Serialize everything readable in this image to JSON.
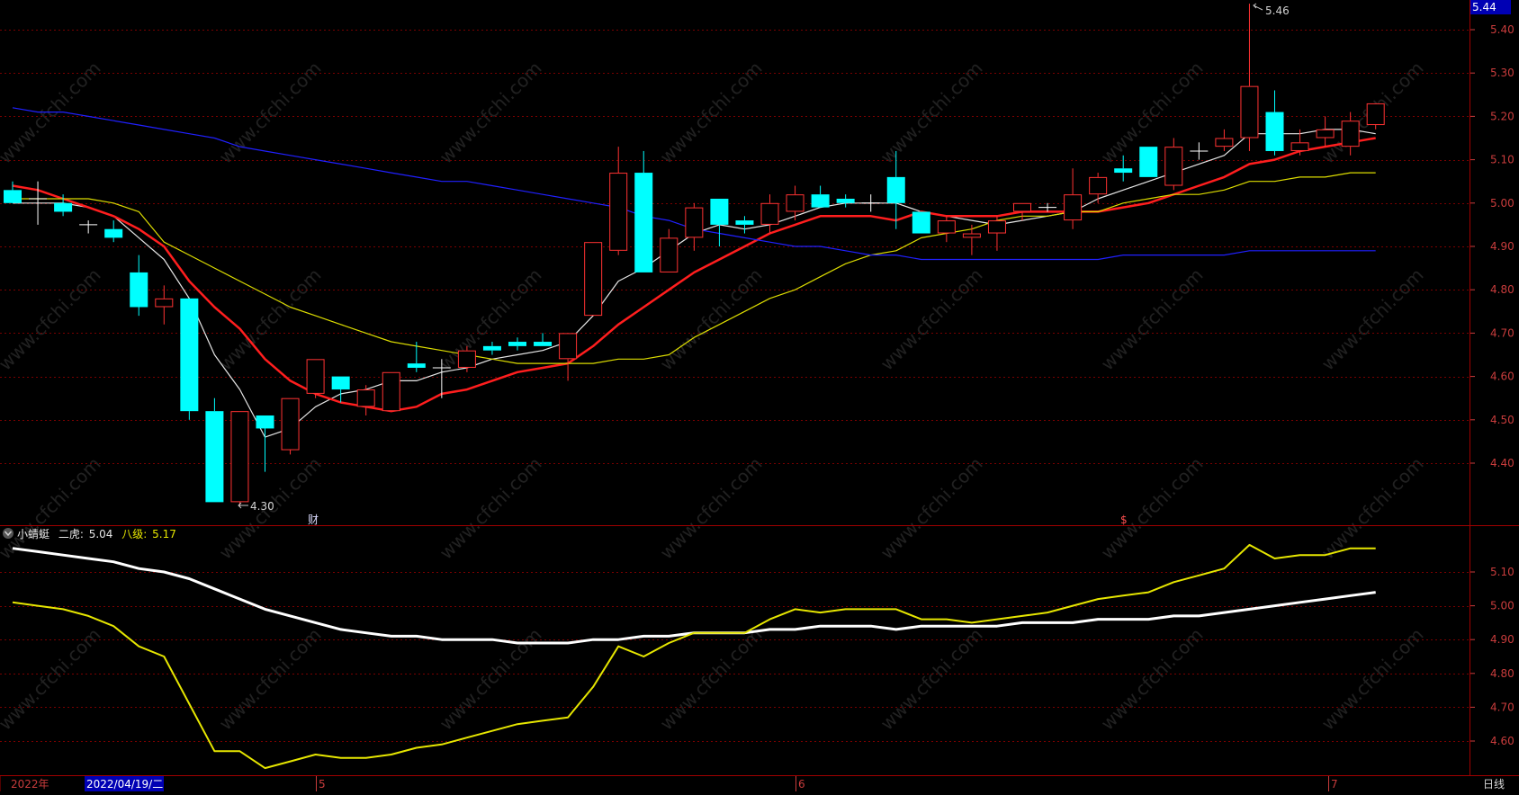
{
  "colors": {
    "background": "#000000",
    "up_candle": "#ff3232",
    "down_candle": "#00ffff",
    "grid": "#7a0000",
    "axis_text": "#c83c3c",
    "ma_white": "#e6e6e6",
    "ma_red": "#ff1e1e",
    "ma_yellow": "#dcdc00",
    "ma_blue": "#2020ff"
  },
  "price_axis": {
    "current_price": "5.44",
    "ticks": [
      "5.40",
      "5.30",
      "5.20",
      "5.10",
      "5.00",
      "4.90",
      "4.80",
      "4.70",
      "4.60",
      "4.50",
      "4.40"
    ]
  },
  "annotations": {
    "high": "5.46",
    "low": "4.30",
    "finance_marker": "财",
    "dollar_marker": "$"
  },
  "indicator": {
    "name": "小蜻蜓",
    "line1_label": "二虎:",
    "line1_value": "5.04",
    "line2_label": "八级:",
    "line2_value": "5.17",
    "ticks": [
      "5.10",
      "5.00",
      "4.90",
      "4.80",
      "4.70",
      "4.60"
    ]
  },
  "date_axis": {
    "year_label": "2022年",
    "selected_date": "2022/04/19/二",
    "month_labels": [
      "5",
      "6",
      "7"
    ],
    "period_label": "日线"
  },
  "watermark": "www.cfchi.com",
  "chart_data": [
    {
      "type": "candlestick",
      "title": "",
      "ylim": [
        4.25,
        5.47
      ],
      "grid": true,
      "candles": [
        {
          "o": 5.03,
          "h": 5.05,
          "l": 5.0,
          "c": 5.0
        },
        {
          "o": 5.01,
          "h": 5.05,
          "l": 4.95,
          "c": 5.01
        },
        {
          "o": 5.0,
          "h": 5.02,
          "l": 4.97,
          "c": 4.98
        },
        {
          "o": 4.95,
          "h": 4.96,
          "l": 4.93,
          "c": 4.95
        },
        {
          "o": 4.94,
          "h": 4.96,
          "l": 4.91,
          "c": 4.92
        },
        {
          "o": 4.84,
          "h": 4.88,
          "l": 4.74,
          "c": 4.76
        },
        {
          "o": 4.76,
          "h": 4.81,
          "l": 4.72,
          "c": 4.78
        },
        {
          "o": 4.78,
          "h": 4.78,
          "l": 4.5,
          "c": 4.52
        },
        {
          "o": 4.52,
          "h": 4.55,
          "l": 4.31,
          "c": 4.31
        },
        {
          "o": 4.31,
          "h": 4.52,
          "l": 4.3,
          "c": 4.52
        },
        {
          "o": 4.51,
          "h": 4.51,
          "l": 4.38,
          "c": 4.48
        },
        {
          "o": 4.43,
          "h": 4.55,
          "l": 4.42,
          "c": 4.55
        },
        {
          "o": 4.56,
          "h": 4.64,
          "l": 4.55,
          "c": 4.64
        },
        {
          "o": 4.6,
          "h": 4.6,
          "l": 4.54,
          "c": 4.57
        },
        {
          "o": 4.53,
          "h": 4.58,
          "l": 4.51,
          "c": 4.57
        },
        {
          "o": 4.52,
          "h": 4.61,
          "l": 4.52,
          "c": 4.61
        },
        {
          "o": 4.63,
          "h": 4.68,
          "l": 4.61,
          "c": 4.62
        },
        {
          "o": 4.62,
          "h": 4.64,
          "l": 4.55,
          "c": 4.62
        },
        {
          "o": 4.62,
          "h": 4.67,
          "l": 4.61,
          "c": 4.66
        },
        {
          "o": 4.67,
          "h": 4.68,
          "l": 4.65,
          "c": 4.66
        },
        {
          "o": 4.68,
          "h": 4.69,
          "l": 4.66,
          "c": 4.67
        },
        {
          "o": 4.68,
          "h": 4.7,
          "l": 4.67,
          "c": 4.67
        },
        {
          "o": 4.64,
          "h": 4.7,
          "l": 4.59,
          "c": 4.7
        },
        {
          "o": 4.74,
          "h": 4.91,
          "l": 4.74,
          "c": 4.91
        },
        {
          "o": 4.89,
          "h": 5.13,
          "l": 4.88,
          "c": 5.07
        },
        {
          "o": 5.07,
          "h": 5.12,
          "l": 4.84,
          "c": 4.84
        },
        {
          "o": 4.84,
          "h": 4.94,
          "l": 4.84,
          "c": 4.92
        },
        {
          "o": 4.92,
          "h": 5.0,
          "l": 4.89,
          "c": 4.99
        },
        {
          "o": 5.01,
          "h": 5.01,
          "l": 4.9,
          "c": 4.95
        },
        {
          "o": 4.96,
          "h": 4.97,
          "l": 4.93,
          "c": 4.95
        },
        {
          "o": 4.95,
          "h": 5.02,
          "l": 4.93,
          "c": 5.0
        },
        {
          "o": 4.98,
          "h": 5.04,
          "l": 4.96,
          "c": 5.02
        },
        {
          "o": 5.02,
          "h": 5.04,
          "l": 4.99,
          "c": 4.99
        },
        {
          "o": 5.01,
          "h": 5.02,
          "l": 4.99,
          "c": 5.0
        },
        {
          "o": 5.0,
          "h": 5.02,
          "l": 4.98,
          "c": 5.0
        },
        {
          "o": 5.06,
          "h": 5.12,
          "l": 4.94,
          "c": 5.0
        },
        {
          "o": 4.98,
          "h": 4.98,
          "l": 4.93,
          "c": 4.93
        },
        {
          "o": 4.93,
          "h": 4.97,
          "l": 4.91,
          "c": 4.96
        },
        {
          "o": 4.92,
          "h": 4.95,
          "l": 4.88,
          "c": 4.93
        },
        {
          "o": 4.93,
          "h": 4.97,
          "l": 4.89,
          "c": 4.96
        },
        {
          "o": 4.98,
          "h": 5.0,
          "l": 4.96,
          "c": 5.0
        },
        {
          "o": 4.99,
          "h": 5.0,
          "l": 4.98,
          "c": 4.99
        },
        {
          "o": 4.96,
          "h": 5.08,
          "l": 4.94,
          "c": 5.02
        },
        {
          "o": 5.02,
          "h": 5.07,
          "l": 5.0,
          "c": 5.06
        },
        {
          "o": 5.08,
          "h": 5.11,
          "l": 5.05,
          "c": 5.07
        },
        {
          "o": 5.13,
          "h": 5.13,
          "l": 5.06,
          "c": 5.06
        },
        {
          "o": 5.04,
          "h": 5.15,
          "l": 5.03,
          "c": 5.13
        },
        {
          "o": 5.12,
          "h": 5.14,
          "l": 5.1,
          "c": 5.12
        },
        {
          "o": 5.13,
          "h": 5.17,
          "l": 5.12,
          "c": 5.15
        },
        {
          "o": 5.15,
          "h": 5.46,
          "l": 5.12,
          "c": 5.27
        },
        {
          "o": 5.21,
          "h": 5.26,
          "l": 5.11,
          "c": 5.12
        },
        {
          "o": 5.12,
          "h": 5.17,
          "l": 5.11,
          "c": 5.14
        },
        {
          "o": 5.15,
          "h": 5.2,
          "l": 5.13,
          "c": 5.17
        },
        {
          "o": 5.13,
          "h": 5.21,
          "l": 5.11,
          "c": 5.19
        },
        {
          "o": 5.18,
          "h": 5.23,
          "l": 5.17,
          "c": 5.23
        }
      ],
      "series": [
        {
          "color": "#e6e6e6",
          "values": [
            5.0,
            5.0,
            5.0,
            4.99,
            4.97,
            4.92,
            4.87,
            4.78,
            4.65,
            4.57,
            4.46,
            4.48,
            4.53,
            4.56,
            4.57,
            4.59,
            4.59,
            4.61,
            4.62,
            4.64,
            4.65,
            4.66,
            4.68,
            4.74,
            4.82,
            4.85,
            4.89,
            4.93,
            4.95,
            4.94,
            4.95,
            4.97,
            4.99,
            5.0,
            5.0,
            5.0,
            4.98,
            4.97,
            4.96,
            4.95,
            4.96,
            4.97,
            4.98,
            5.01,
            5.03,
            5.05,
            5.07,
            5.09,
            5.11,
            5.16,
            5.16,
            5.16,
            5.17,
            5.17,
            5.16
          ]
        },
        {
          "color": "#ff1e1e",
          "values": [
            5.04,
            5.03,
            5.01,
            4.99,
            4.97,
            4.94,
            4.9,
            4.82,
            4.76,
            4.71,
            4.64,
            4.59,
            4.56,
            4.54,
            4.53,
            4.52,
            4.53,
            4.56,
            4.57,
            4.59,
            4.61,
            4.62,
            4.63,
            4.67,
            4.72,
            4.76,
            4.8,
            4.84,
            4.87,
            4.9,
            4.93,
            4.95,
            4.97,
            4.97,
            4.97,
            4.96,
            4.98,
            4.97,
            4.97,
            4.97,
            4.98,
            4.98,
            4.98,
            4.98,
            4.99,
            5.0,
            5.02,
            5.04,
            5.06,
            5.09,
            5.1,
            5.12,
            5.13,
            5.14,
            5.15
          ]
        },
        {
          "color": "#dcdc00",
          "values": [
            5.01,
            5.01,
            5.01,
            5.01,
            5.0,
            4.98,
            4.91,
            4.88,
            4.85,
            4.82,
            4.79,
            4.76,
            4.74,
            4.72,
            4.7,
            4.68,
            4.67,
            4.66,
            4.65,
            4.64,
            4.63,
            4.63,
            4.63,
            4.63,
            4.64,
            4.64,
            4.65,
            4.69,
            4.72,
            4.75,
            4.78,
            4.8,
            4.83,
            4.86,
            4.88,
            4.89,
            4.92,
            4.93,
            4.94,
            4.96,
            4.97,
            4.97,
            4.98,
            4.98,
            5.0,
            5.01,
            5.02,
            5.02,
            5.03,
            5.05,
            5.05,
            5.06,
            5.06,
            5.07,
            5.07
          ]
        },
        {
          "color": "#2020ff",
          "values": [
            5.22,
            5.21,
            5.21,
            5.2,
            5.19,
            5.18,
            5.17,
            5.16,
            5.15,
            5.13,
            5.12,
            5.11,
            5.1,
            5.09,
            5.08,
            5.07,
            5.06,
            5.05,
            5.05,
            5.04,
            5.03,
            5.02,
            5.01,
            5.0,
            4.99,
            4.97,
            4.96,
            4.94,
            4.93,
            4.92,
            4.91,
            4.9,
            4.9,
            4.89,
            4.88,
            4.88,
            4.87,
            4.87,
            4.87,
            4.87,
            4.87,
            4.87,
            4.87,
            4.87,
            4.88,
            4.88,
            4.88,
            4.88,
            4.88,
            4.89,
            4.89,
            4.89,
            4.89,
            4.89,
            4.89
          ]
        }
      ]
    },
    {
      "type": "line",
      "title": "",
      "ylim": [
        4.52,
        5.23
      ],
      "grid": true,
      "series": [
        {
          "name": "二虎",
          "color": "#ffffff",
          "values": [
            5.17,
            5.16,
            5.15,
            5.14,
            5.13,
            5.11,
            5.1,
            5.08,
            5.05,
            5.02,
            4.99,
            4.97,
            4.95,
            4.93,
            4.92,
            4.91,
            4.91,
            4.9,
            4.9,
            4.9,
            4.89,
            4.89,
            4.89,
            4.9,
            4.9,
            4.91,
            4.91,
            4.92,
            4.92,
            4.92,
            4.93,
            4.93,
            4.94,
            4.94,
            4.94,
            4.93,
            4.94,
            4.94,
            4.94,
            4.94,
            4.95,
            4.95,
            4.95,
            4.96,
            4.96,
            4.96,
            4.97,
            4.97,
            4.98,
            4.99,
            5.0,
            5.01,
            5.02,
            5.03,
            5.04
          ]
        },
        {
          "name": "八级",
          "color": "#e6e600",
          "values": [
            5.01,
            5.0,
            4.99,
            4.97,
            4.94,
            4.88,
            4.85,
            4.71,
            4.57,
            4.57,
            4.52,
            4.54,
            4.56,
            4.55,
            4.55,
            4.56,
            4.58,
            4.59,
            4.61,
            4.63,
            4.65,
            4.66,
            4.67,
            4.76,
            4.88,
            4.85,
            4.89,
            4.92,
            4.92,
            4.92,
            4.96,
            4.99,
            4.98,
            4.99,
            4.99,
            4.99,
            4.96,
            4.96,
            4.95,
            4.96,
            4.97,
            4.98,
            5.0,
            5.02,
            5.03,
            5.04,
            5.07,
            5.09,
            5.11,
            5.18,
            5.14,
            5.15,
            5.15,
            5.17,
            5.17
          ]
        }
      ]
    }
  ]
}
